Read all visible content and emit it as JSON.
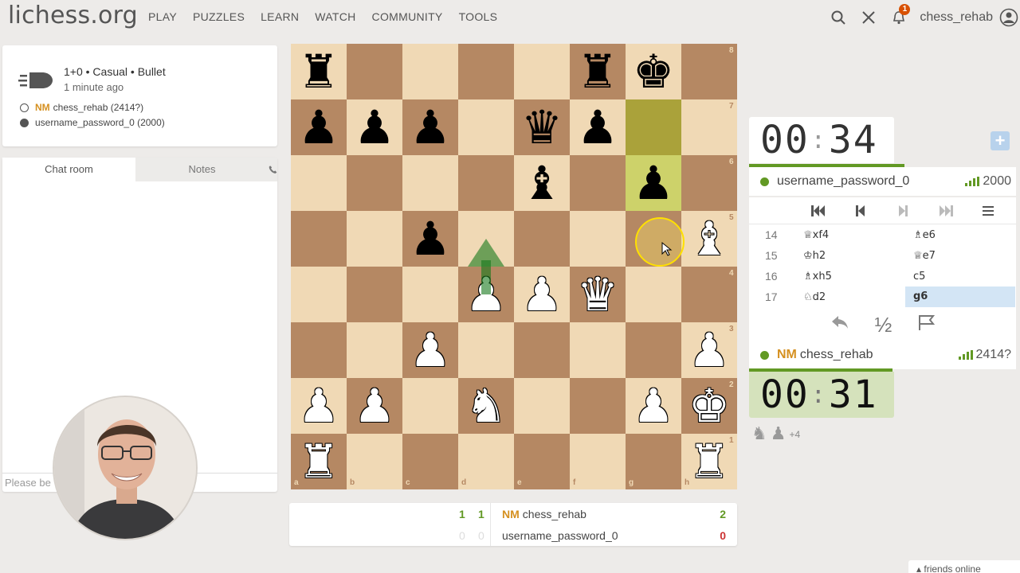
{
  "header": {
    "logo": "lichess.org",
    "nav": [
      "PLAY",
      "PUZZLES",
      "LEARN",
      "WATCH",
      "COMMUNITY",
      "TOOLS"
    ],
    "notification_count": "1",
    "username": "chess_rehab"
  },
  "game_info": {
    "setup": "1+0 • Casual • Bullet",
    "time_ago": "1 minute ago",
    "white_title": "NM",
    "white_player": "chess_rehab (2414?)",
    "black_player": "username_password_0 (2000)"
  },
  "chat": {
    "tab_chat": "Chat room",
    "tab_notes": "Notes",
    "input_placeholder": "Please be"
  },
  "board": {
    "ranks": [
      "8",
      "7",
      "6",
      "5",
      "4",
      "3",
      "2",
      "1"
    ],
    "files": [
      "a",
      "b",
      "c",
      "d",
      "e",
      "f",
      "g",
      "h"
    ],
    "pieces": [
      {
        "sq": "a8",
        "p": "♜",
        "c": "b"
      },
      {
        "sq": "f8",
        "p": "♜",
        "c": "b"
      },
      {
        "sq": "g8",
        "p": "♚",
        "c": "b"
      },
      {
        "sq": "a7",
        "p": "♟",
        "c": "b"
      },
      {
        "sq": "b7",
        "p": "♟",
        "c": "b"
      },
      {
        "sq": "c7",
        "p": "♟",
        "c": "b"
      },
      {
        "sq": "e7",
        "p": "♛",
        "c": "b"
      },
      {
        "sq": "f7",
        "p": "♟",
        "c": "b"
      },
      {
        "sq": "e6",
        "p": "♝",
        "c": "b"
      },
      {
        "sq": "g6",
        "p": "♟",
        "c": "b"
      },
      {
        "sq": "c5",
        "p": "♟",
        "c": "b"
      },
      {
        "sq": "h5",
        "p": "♗",
        "c": "w"
      },
      {
        "sq": "d4",
        "p": "♙",
        "c": "w"
      },
      {
        "sq": "e4",
        "p": "♙",
        "c": "w"
      },
      {
        "sq": "f4",
        "p": "♕",
        "c": "w"
      },
      {
        "sq": "c3",
        "p": "♙",
        "c": "w"
      },
      {
        "sq": "h3",
        "p": "♙",
        "c": "w"
      },
      {
        "sq": "a2",
        "p": "♙",
        "c": "w"
      },
      {
        "sq": "b2",
        "p": "♙",
        "c": "w"
      },
      {
        "sq": "d2",
        "p": "♘",
        "c": "w"
      },
      {
        "sq": "g2",
        "p": "♙",
        "c": "w"
      },
      {
        "sq": "h2",
        "p": "♔",
        "c": "w"
      },
      {
        "sq": "a1",
        "p": "♖",
        "c": "w"
      },
      {
        "sq": "h1",
        "p": "♖",
        "c": "w"
      }
    ],
    "last_move": [
      "g7",
      "g6"
    ]
  },
  "clocks": {
    "top": {
      "min": "00",
      "sec": "34"
    },
    "bottom": {
      "min": "00",
      "sec": "31"
    }
  },
  "players": {
    "top": {
      "name": "username_password_0",
      "rating": "2000"
    },
    "bottom": {
      "title": "NM",
      "name": "chess_rehab",
      "rating": "2414?"
    }
  },
  "moves": [
    {
      "n": "14",
      "w": "♕xf4",
      "b": "♗e6"
    },
    {
      "n": "15",
      "w": "♔h2",
      "b": "♕e7"
    },
    {
      "n": "16",
      "w": "♗xh5",
      "b": "c5"
    },
    {
      "n": "17",
      "w": "♘d2",
      "b": "g6"
    }
  ],
  "material": {
    "diff": "+4"
  },
  "scoreboard": {
    "row1": {
      "s1": "1",
      "s2": "1",
      "title": "NM",
      "name": "chess_rehab",
      "total": "2"
    },
    "row2": {
      "s1": "0",
      "s2": "0",
      "name": "username_password_0",
      "total": "0"
    }
  },
  "footer": {
    "friends": "friends online"
  },
  "colors": {
    "accent": "#629924",
    "title": "#d59020",
    "loss": "#cc3333"
  }
}
